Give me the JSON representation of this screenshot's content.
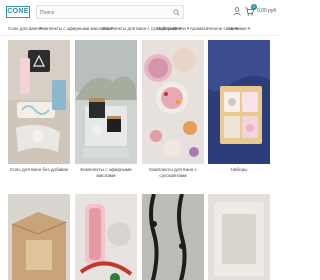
{
  "header": {
    "logo": "CONE",
    "search_placeholder": "Поиск",
    "cart_count": "0",
    "cart_total": "0,00 руб"
  },
  "nav": {
    "items": [
      {
        "label": "Соль для ванн"
      },
      {
        "label": "Комплекты с эфирными маслами"
      },
      {
        "label": "Комплекты для ванн с сухоцветами"
      },
      {
        "label": "Наборы"
      },
      {
        "label": "Свечи"
      },
      {
        "label": "Ароматическое саше"
      },
      {
        "label": "Новинки"
      }
    ]
  },
  "categories": [
    {
      "label": "Соль для ванн без добавок"
    },
    {
      "label": "Комплекты с эфирными маслами"
    },
    {
      "label": "Комплекты для ванн с сухоцветами"
    },
    {
      "label": "Наборы"
    }
  ],
  "colors": {
    "accent": "#2f8fa6"
  }
}
